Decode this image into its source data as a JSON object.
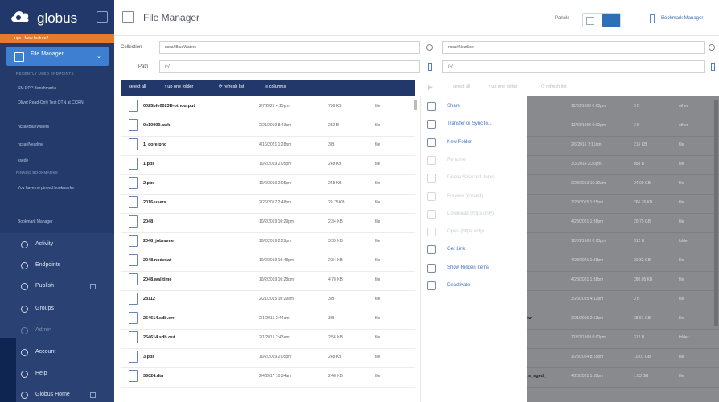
{
  "sidebar": {
    "brand": "globus",
    "notice": "ups · New feature?",
    "file_manager_label": "File Manager",
    "recent_header": "RECENTLY USED ENDPOINTS",
    "recent": [
      "SM DPP Benchmarks",
      "Olivet Read-Only Test DTN at CCRN",
      "ncsa#BlueWaters",
      "ncsa#Nearline",
      "xsede"
    ],
    "pinned_header": "PINNED BOOKMARKS",
    "pinned_empty": "You have no pinned bookmarks",
    "bookmark_manager": "Bookmark Manager",
    "nav": [
      "Activity",
      "Endpoints",
      "Publish",
      "Groups",
      "Admin",
      "Account",
      "Help",
      "Globus Home"
    ]
  },
  "header": {
    "title": "File Manager",
    "panels_label": "Panels",
    "bookmark_link": "Bookmark Manager"
  },
  "left": {
    "collection_label": "Collection",
    "collection_value": "ncsa#BlueWaters",
    "path_label": "Path",
    "path_value": "/~/"
  },
  "right": {
    "collection_value": "ncsa#Nearline",
    "path_value": "/~/"
  },
  "toolbar": {
    "select_all": "select all",
    "up_folder": "up one folder",
    "refresh": "refresh list",
    "columns": "columns"
  },
  "toolbar_right": {
    "select_all": "select all",
    "up_folder": "up one folder",
    "refresh": "refresh list"
  },
  "files_left": [
    {
      "name": "0025bfe0023B-otnoutput",
      "date": "2/7/2021 4:15pm",
      "size": "758 KB",
      "perm": "file"
    },
    {
      "name": "0x10000.awk",
      "date": "2/21/2019 8:43am",
      "size": "282 B",
      "perm": "file"
    },
    {
      "name": "1_core.png",
      "date": "4/16/2021 1:28pm",
      "size": "3 B",
      "perm": "file"
    },
    {
      "name": "1.pbs",
      "date": "10/2/2019 2:05pm",
      "size": "248 KB",
      "perm": "file"
    },
    {
      "name": "2.pbs",
      "date": "10/2/2019 2:05pm",
      "size": "248 KB",
      "perm": "file"
    },
    {
      "name": "2016-users",
      "date": "2/26/2017 2:48pm",
      "size": "29.75 KB",
      "perm": "file"
    },
    {
      "name": "2048",
      "date": "10/2/2019 10:29pm",
      "size": "2.34 KB",
      "perm": "file"
    },
    {
      "name": "2048_jobname",
      "date": "10/2/2019 2:29pm",
      "size": "3.35 KB",
      "perm": "file"
    },
    {
      "name": "2048.nodesat",
      "date": "10/2/2019 10:48pm",
      "size": "2.34 KB",
      "perm": "file"
    },
    {
      "name": "2048.walltime",
      "date": "10/2/2019 10:28pm",
      "size": "4.78 KB",
      "perm": "file"
    },
    {
      "name": "28112",
      "date": "2/21/2015 10:29am",
      "size": "3 B",
      "perm": "file"
    },
    {
      "name": "264614.sdb.err",
      "date": "2/1/2015 2:44am",
      "size": "3 B",
      "perm": "file"
    },
    {
      "name": "264614.sdb.out",
      "date": "2/1/2015 2:43am",
      "size": "2.56 KB",
      "perm": "file"
    },
    {
      "name": "3.pbs",
      "date": "10/2/2019 2:05pm",
      "size": "248 KB",
      "perm": "file"
    },
    {
      "name": "35024.dtn",
      "date": "2/4/2017 10:34am",
      "size": "2.48 KB",
      "perm": "file"
    }
  ],
  "menu": [
    {
      "label": "Share",
      "enabled": true,
      "icon": "share-icon"
    },
    {
      "label": "Transfer or Sync to...",
      "enabled": true,
      "icon": "transfer-icon"
    },
    {
      "label": "New Folder",
      "enabled": true,
      "icon": "new-folder-icon"
    },
    {
      "label": "Rename",
      "enabled": false,
      "icon": "rename-icon"
    },
    {
      "label": "Delete Selected Items",
      "enabled": false,
      "icon": "delete-icon"
    },
    {
      "label": "Preview (limited)",
      "enabled": false,
      "icon": "preview-icon"
    },
    {
      "label": "Download (https only)",
      "enabled": false,
      "icon": "download-icon"
    },
    {
      "label": "Open (https only)",
      "enabled": false,
      "icon": "open-icon"
    },
    {
      "label": "Get Link",
      "enabled": true,
      "icon": "link-icon"
    },
    {
      "label": "Show Hidden Items",
      "enabled": true,
      "icon": "hidden-icon"
    },
    {
      "label": "Deactivate",
      "enabled": true,
      "icon": "deactivate-icon"
    }
  ],
  "files_right": [
    {
      "name": "",
      "date": "12/31/1969 6:00pm",
      "size": "3 B",
      "perm": "other"
    },
    {
      "name": "",
      "date": "12/31/1969 6:00pm",
      "size": "3 B",
      "perm": "other"
    },
    {
      "name": "",
      "date": "2/6/2016 7:16pm",
      "size": "216 KB",
      "perm": "file"
    },
    {
      "name": "",
      "date": "3/3/2014 2:30pm",
      "size": "858 B",
      "perm": "file"
    },
    {
      "name": "",
      "date": "2/28/2013 10:32am",
      "size": "24.00 GB",
      "perm": "file"
    },
    {
      "name": "",
      "date": "3/28/2015 1:25pm",
      "size": "266.76 KB",
      "perm": "file"
    },
    {
      "name": "",
      "date": "4/28/2021 1:38pm",
      "size": "20.75 GB",
      "perm": "file"
    },
    {
      "name": "",
      "date": "12/31/1969 6:00pm",
      "size": "312 B",
      "perm": "folder"
    },
    {
      "name": "",
      "date": "4/28/2021 1:38pm",
      "size": "20.32 GB",
      "perm": "file"
    },
    {
      "name": "",
      "date": "4/28/2021 1:38pm",
      "size": "280.05 KB",
      "perm": "file"
    },
    {
      "name": "",
      "date": "3/28/2015 4:12pm",
      "size": "3 B",
      "perm": "file"
    },
    {
      "name": "tar",
      "date": "2/21/2015 2:53pm",
      "size": "38.61 GB",
      "perm": "file"
    },
    {
      "name": "",
      "date": "12/31/1969 6:00pm",
      "size": "312 B",
      "perm": "folder"
    },
    {
      "name": "",
      "date": "1/28/2014 8:55pm",
      "size": "10.07 GB",
      "perm": "file"
    },
    {
      "name": "_s_sged_",
      "date": "4/28/2021 1:38pm",
      "size": "1.03 GB",
      "perm": "file"
    }
  ]
}
